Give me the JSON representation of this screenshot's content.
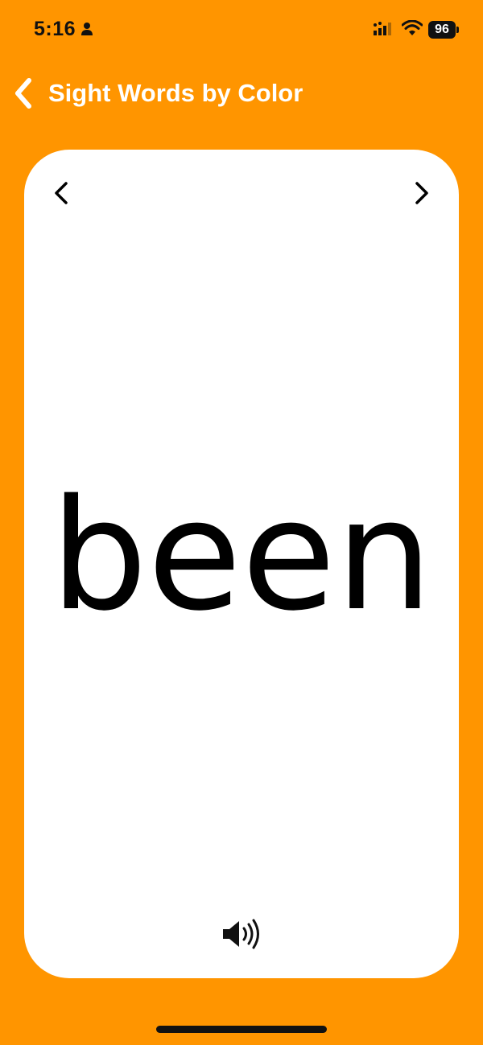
{
  "status_bar": {
    "time": "5:16",
    "battery_level": "96",
    "icons": [
      "person-icon",
      "signal-icon",
      "wifi-icon",
      "battery-icon"
    ]
  },
  "nav": {
    "title": "Sight Words by Color",
    "back_icon": "chevron-left-icon"
  },
  "card": {
    "word": "been",
    "prev_icon": "chevron-left-icon",
    "next_icon": "chevron-right-icon",
    "audio_icon": "speaker-icon"
  },
  "colors": {
    "background": "#FF9500",
    "card": "#FFFFFF",
    "text": "#000000",
    "nav_text": "#FFFFFF"
  }
}
